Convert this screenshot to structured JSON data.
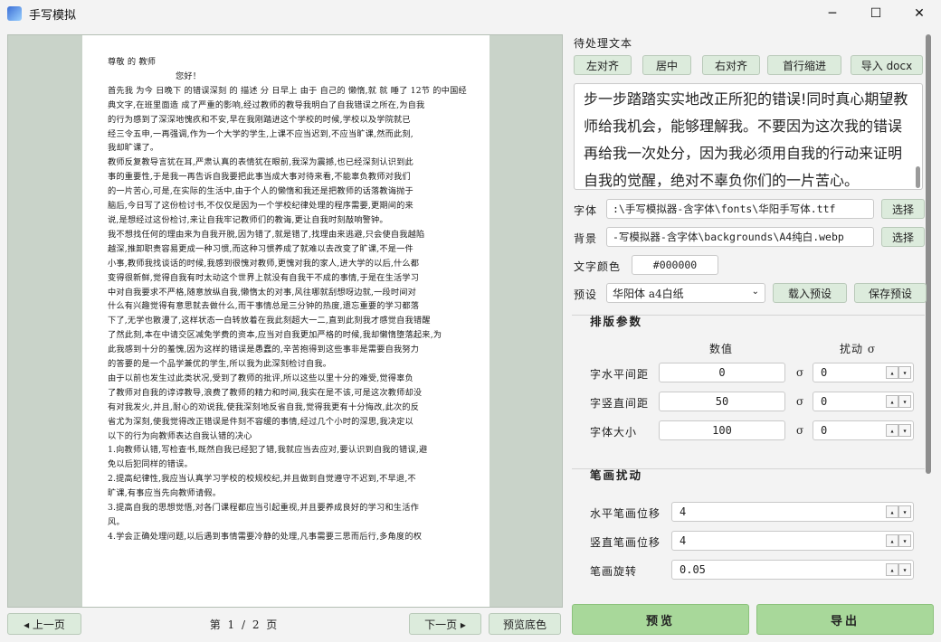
{
  "window": {
    "title": "手写模拟",
    "minimize": "─",
    "maximize": "☐",
    "close": "✕"
  },
  "preview": {
    "lines": [
      "尊敬 的 教师",
      "您好！",
      "首先我 为今 日晚下 的错误深刻 的 描述 分 日早上 由于 自己的 懒惰,就 就 睡了 12节 的中国经",
      "典文字,在班里面造 成了严重的影响,经过教师的教导我明白了自我错误之所在,为自我",
      "的行为感到了深深地愧疚和不安,早在我刚踏进这个学校的时候,学校以及学院就已",
      "经三令五申,一再强调,作为一个大学的学生,上课不应当迟到,不应当旷课,然而此刻,",
      "我却旷课了。",
      "教师反复教导言犹在耳,严肃认真的表情犹在眼前,我深为震撼,也已经深刻认识到此",
      "事的重要性,于是我一再告诉自我要把此事当成大事对待来看,不能辜负教师对我们",
      "的一片苦心,可是,在实际的生活中,由于个人的懒惰和我还是把教师的话落教诲抛于",
      "脑后,今日写了这份检讨书,不仅仅是因为一个学校纪律处理的程序需要,更期间的来",
      "说,是想经过这份检讨,来让自我牢记教师们的教诲,更让自我时刻敲响警钟。",
      "我不想找任何的理由来为自我开脱,因为错了,就是错了,找理由来逃避,只会使自我越陷",
      "越深,推卸职责容易更成一种习惯,而这种习惯养成了就难以去改变了旷课,不是一件",
      "小事,教师我找谈话的时候,我感到很愧对教师,更愧对我的家人,进大学的以后,什么都",
      "变得很新鲜,觉得自我有时太动这个世界上就没有自我干不成的事情,于是在生活学习",
      "中对自我要求不严格,随意放纵自我,懒惰太的对事,风往哪就刮想呀边就,一段时间对",
      "什么有兴趣觉得有意思就去做什么,而干事情总是三分钟的热度,遗忘重要的学习都落",
      "下了,无学也散漫了,这样状态一白转放着在我此刻超大一二,直到此刻我才感觉自我错醒",
      "了然此刻,本在中请交区减免学费的资本,应当对自我更加严格的时候,我却懒惰堕落起来,为",
      "此我感到十分的羞愧,因为这样的错误是愚蠢的,辛苦抱得到这些事非是需要自我努力",
      "的答要的是一个品学兼优的学生,所以我为此深刻检讨自我。",
      "由于以前也发生过此类状况,受到了教师的批评,所以这些以里十分的难受,觉得辜负",
      "了教师对自我的谆谆教导,浪费了教师的精力和时间,我实在是不该,可是这次教师却没",
      "有对我发火,并且,耐心的劝说我,使我深刻地反省自我,觉得我更有十分悔改,此次的反",
      "省尤为深刻,使我觉得改正错误是件刻不容缓的事情,经过几个小时的深思,我决定以",
      "以下的行为向教师表达自我认错的决心",
      "1.向教师认错,写检查书,既然自我已经犯了错,我就应当去应对,要认识到自我的错误,避",
      "免以后犯同样的错误。",
      "2.提高纪律性,我应当认真学习学校的校规校纪,并且做到自觉遵守不迟到,不早退,不",
      "旷课,有事应当先向教师请假。",
      "3.提高自我的思想觉悟,对各门课程都应当引起重视,并且要养成良好的学习和生活作",
      "风。",
      "4.学会正确处理问题,以后遇到事情需要冷静的处理,凡事需要三思而后行,多角度的权"
    ]
  },
  "pager": {
    "prev_label": "◂  上一页",
    "page_text": "第 1 / 2 页",
    "next_label": "下一页  ▸",
    "preview_bg_label": "预览底色"
  },
  "panel": {
    "text_section_label": "待处理文本",
    "toolbar": {
      "align_left": "左对齐",
      "center": "居中",
      "align_right": "右对齐",
      "indent": "首行缩进",
      "import_docx": "导入 docx"
    },
    "text_lines": [
      "步一步踏踏实实地改正所犯的错误!同时真心期望教",
      "师给我机会，能够理解我。不要因为这次我的错误",
      "再给我一次处分，因为我必须用自我的行动来证明",
      "自我的觉醒，绝对不辜负你们的一片苦心。"
    ],
    "font_label": "字体",
    "font_path": ":\\手写模拟器-含字体\\fonts\\华阳手写体.ttf",
    "font_choose": "选择",
    "bg_label": "背景",
    "bg_path": "-写模拟器-含字体\\backgrounds\\A4纯白.webp",
    "bg_choose": "选择",
    "color_label": "文字颜色",
    "color_value": "#000000",
    "preset_label": "预设",
    "preset_value": "华阳体 a4白纸",
    "load_preset": "载入预设",
    "save_preset": "保存预设",
    "layout_group": {
      "title": "排版参数",
      "col_value": "数值",
      "col_jitter": "扰动 σ",
      "rows": [
        {
          "label": "字水平间距",
          "value": "0",
          "sigma": "σ",
          "jitter": "0"
        },
        {
          "label": "字竖直间距",
          "value": "50",
          "sigma": "σ",
          "jitter": "0"
        },
        {
          "label": "字体大小",
          "value": "100",
          "sigma": "σ",
          "jitter": "0"
        }
      ]
    },
    "stroke_group": {
      "title": "笔画扰动",
      "rows": [
        {
          "label": "水平笔画位移",
          "value": "4"
        },
        {
          "label": "竖直笔画位移",
          "value": "4"
        },
        {
          "label": "笔画旋转",
          "value": "0.05"
        }
      ]
    },
    "preview_button": "预览",
    "export_button": "导出"
  }
}
